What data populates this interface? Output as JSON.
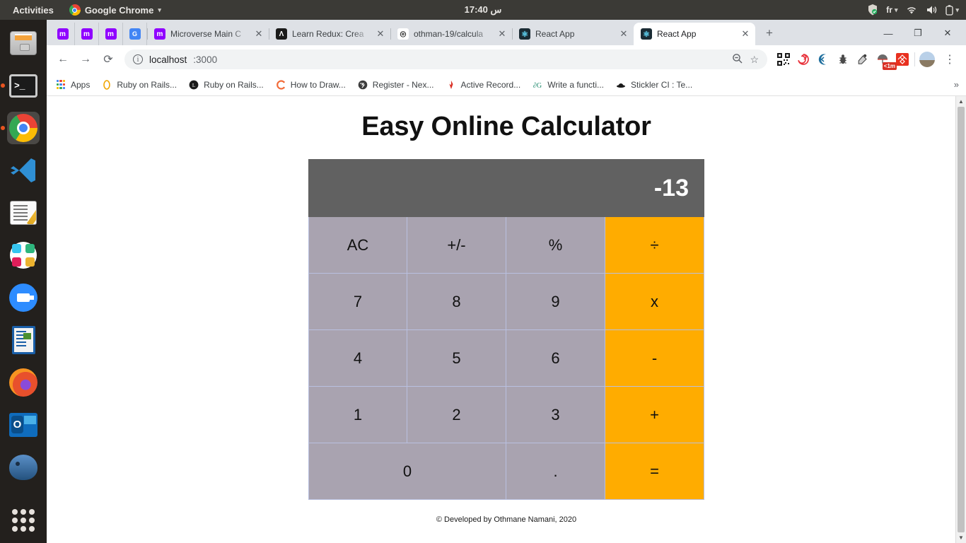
{
  "desktop": {
    "activities": "Activities",
    "app_menu": {
      "label": "Google Chrome",
      "icon": "chrome-icon",
      "caret": "▾"
    },
    "clock": "17:40 س",
    "tray": {
      "shield": "shield-icon",
      "language": "fr",
      "language_caret": "▾",
      "wifi": "wifi-icon",
      "volume": "volume-icon",
      "battery": "battery-icon",
      "system_caret": "▾"
    }
  },
  "dock": {
    "items": [
      {
        "name": "files",
        "icon": "files-icon",
        "running": false,
        "active": false
      },
      {
        "name": "terminal",
        "icon": "terminal-icon",
        "running": true,
        "active": false
      },
      {
        "name": "google-chrome",
        "icon": "chrome-icon",
        "running": true,
        "active": true
      },
      {
        "name": "visual-studio-code",
        "icon": "vscode-icon",
        "running": false,
        "active": false
      },
      {
        "name": "text-editor",
        "icon": "text-editor-icon",
        "running": false,
        "active": false
      },
      {
        "name": "slack",
        "icon": "slack-icon",
        "running": false,
        "active": false
      },
      {
        "name": "zoom",
        "icon": "zoom-icon",
        "running": false,
        "active": false
      },
      {
        "name": "libreoffice-writer",
        "icon": "libreoffice-writer-icon",
        "running": false,
        "active": false
      },
      {
        "name": "firefox",
        "icon": "firefox-icon",
        "running": false,
        "active": false
      },
      {
        "name": "outlook",
        "icon": "outlook-icon",
        "running": false,
        "active": false
      },
      {
        "name": "thunderbird",
        "icon": "thunderbird-icon",
        "running": false,
        "active": false
      }
    ],
    "show_apps": "show-applications-icon"
  },
  "browser": {
    "pinned_tabs": [
      {
        "favicon": "microverse-icon",
        "letter": "m"
      },
      {
        "favicon": "microverse-icon",
        "letter": "m"
      },
      {
        "favicon": "microverse-icon",
        "letter": "m"
      },
      {
        "favicon": "google-translate-icon",
        "letter": "G"
      }
    ],
    "tabs": [
      {
        "title": "Microverse Main C",
        "favicon": "microverse-icon",
        "letter": "m",
        "active": false,
        "close": "✕"
      },
      {
        "title": "Learn Redux: Crea",
        "favicon": "redux-icon",
        "letter": "Λ",
        "active": false,
        "close": "✕"
      },
      {
        "title": "othman-19/calcula",
        "favicon": "github-icon",
        "letter": "⌾",
        "active": false,
        "close": "✕"
      },
      {
        "title": "React App",
        "favicon": "react-icon",
        "letter": "⚛",
        "active": false,
        "close": "✕"
      },
      {
        "title": "React App",
        "favicon": "react-icon",
        "letter": "⚛",
        "active": true,
        "close": "✕"
      }
    ],
    "new_tab": "+",
    "window_controls": {
      "minimize": "—",
      "maximize": "❐",
      "close": "✕"
    },
    "navigation": {
      "back": "←",
      "forward": "→",
      "reload": "⟳"
    },
    "omnibox": {
      "info_icon": "i",
      "url_host": "localhost",
      "url_rest": ":3000",
      "zoom_icon": "🔍",
      "bookmark_star": "☆"
    },
    "extensions": [
      {
        "name": "qr-code-extension",
        "glyph": "▦"
      },
      {
        "name": "red-spiral-extension",
        "glyph": "◎"
      },
      {
        "name": "crescent-extension",
        "glyph": "《"
      },
      {
        "name": "bug-extension",
        "glyph": "🐞"
      },
      {
        "name": "eyedropper-extension",
        "glyph": "✎"
      },
      {
        "name": "umbrella-timer-extension",
        "glyph": "⛱",
        "badge": "<1m"
      },
      {
        "name": "red-square-extension",
        "glyph": "❊"
      }
    ],
    "profile": "profile-avatar",
    "menu": "⋮",
    "bookmarks": [
      {
        "label": "Apps",
        "icon": "apps-grid-icon"
      },
      {
        "label": "Ruby on Rails...",
        "icon": "ruby-on-rails-icon"
      },
      {
        "label": "Ruby on Rails...",
        "icon": "ruby-on-rails-dark-icon"
      },
      {
        "label": "How to Draw...",
        "icon": "how-to-draw-icon"
      },
      {
        "label": "Register - Nex...",
        "icon": "register-globe-icon"
      },
      {
        "label": "Active Record...",
        "icon": "active-record-icon"
      },
      {
        "label": "Write a functi...",
        "icon": "write-function-icon"
      },
      {
        "label": "Stickler CI : Te...",
        "icon": "stickler-ci-icon"
      }
    ],
    "bookmarks_overflow": "»",
    "scrollbar": {
      "up": "▲",
      "down": "▼"
    }
  },
  "page": {
    "title": "Easy Online Calculator",
    "display_value": "-13",
    "keys": [
      {
        "label": "AC",
        "type": "function"
      },
      {
        "label": "+/-",
        "type": "function"
      },
      {
        "label": "%",
        "type": "function"
      },
      {
        "label": "÷",
        "type": "operator"
      },
      {
        "label": "7",
        "type": "digit"
      },
      {
        "label": "8",
        "type": "digit"
      },
      {
        "label": "9",
        "type": "digit"
      },
      {
        "label": "x",
        "type": "operator"
      },
      {
        "label": "4",
        "type": "digit"
      },
      {
        "label": "5",
        "type": "digit"
      },
      {
        "label": "6",
        "type": "digit"
      },
      {
        "label": "-",
        "type": "operator"
      },
      {
        "label": "1",
        "type": "digit"
      },
      {
        "label": "2",
        "type": "digit"
      },
      {
        "label": "3",
        "type": "digit"
      },
      {
        "label": "+",
        "type": "operator"
      },
      {
        "label": "0",
        "type": "digit",
        "wide": true
      },
      {
        "label": ".",
        "type": "digit"
      },
      {
        "label": "=",
        "type": "operator"
      }
    ],
    "footer": "© Developed by Othmane Namani, 2020",
    "colors": {
      "display_bg": "#616161",
      "key_bg": "#a9a3b0",
      "operator_bg": "#ffac00",
      "key_border": "#b9c0e0"
    }
  }
}
